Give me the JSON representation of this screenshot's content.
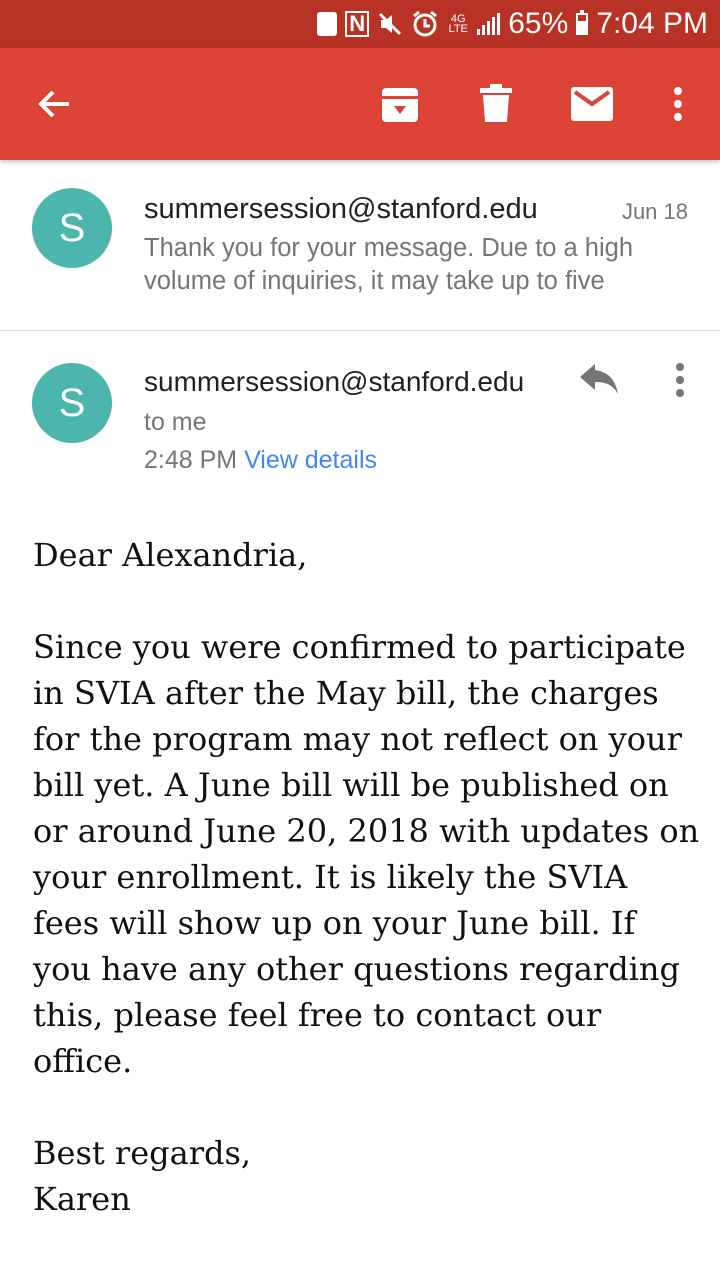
{
  "status_bar": {
    "battery": "65%",
    "time": "7:04 PM",
    "network": "4G LTE",
    "icons": [
      "notification-icon",
      "nfc-icon",
      "mute-icon",
      "alarm-icon",
      "network-type-icon",
      "signal-icon",
      "battery-icon"
    ]
  },
  "toolbar": {
    "color": "#db4437",
    "icons": [
      "back-arrow-icon",
      "archive-icon",
      "trash-icon",
      "mail-icon",
      "more-vert-icon"
    ]
  },
  "thread_preview": {
    "avatar_letter": "S",
    "avatar_color": "#4db6ac",
    "sender": "summersession@stanford.edu",
    "date": "Jun 18",
    "snippet": "Thank you for your message. Due to a high volume of inquiries, it may take up to five"
  },
  "message": {
    "avatar_letter": "S",
    "sender": "summersession@stanford.edu",
    "recipient": "to me",
    "time": "2:48 PM",
    "view_details": "View details",
    "body": {
      "greeting": "Dear Alexandria,",
      "paragraph": "Since you were confirmed to participate in SVIA after the May bill, the charges for the program may not reflect on your bill yet. A June bill will be published on or around June 20, 2018 with updates on your enrollment. It is likely the SVIA fees will show up on your June bill. If you have any other questions regarding this, please feel free to contact our office.",
      "closing": "Best regards,",
      "signature": "Karen"
    }
  }
}
